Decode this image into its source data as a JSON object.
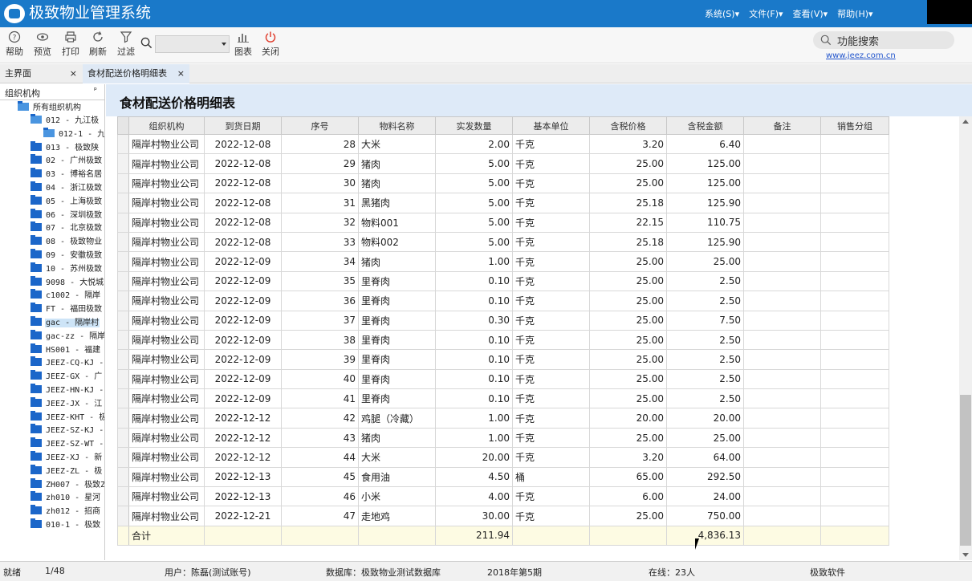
{
  "app": {
    "title": "极致物业管理系统"
  },
  "menu": {
    "items": [
      "系统(S)▾",
      "文件(F)▾",
      "查看(V)▾",
      "帮助(H)▾"
    ]
  },
  "toolbar": {
    "help": "帮助",
    "preview": "预览",
    "print": "打印",
    "refresh": "刷新",
    "filter": "过滤",
    "chart": "图表",
    "close": "关闭",
    "search_value": "",
    "func_search": "功能搜索",
    "site_link": "www.jeez.com.cn"
  },
  "tabs": {
    "main": "主界面",
    "report": "食材配送价格明细表",
    "close": "×"
  },
  "sidebar": {
    "title": "组织机构",
    "pin": "ᵖ",
    "root": "所有组织机构",
    "nodes": [
      "012 - 九江极",
      "012-1 - 九",
      "013 - 极致陕",
      "02 - 广州极致",
      "03 - 博裕名居",
      "04 - 浙江极致",
      "05 - 上海极致",
      "06 - 深圳极致",
      "07 - 北京极致",
      "08 - 极致物业",
      "09 - 安徽极致",
      "10 - 苏州极致",
      "9098 - 大悦城",
      "c1002 - 隔岸",
      "FT - 福田极致",
      "gac - 隔岸村",
      "gac-zz - 隔岸",
      "HS001 - 福建",
      "JEEZ-CQ-KJ -",
      "JEEZ-GX - 广",
      "JEEZ-HN-KJ -",
      "JEEZ-JX - 江",
      "JEEZ-KHT - 极",
      "JEEZ-SZ-KJ -",
      "JEEZ-SZ-WT -",
      "JEEZ-XJ - 新",
      "JEEZ-ZL - 极",
      "ZH007 - 极致Z",
      "zh010 - 星河",
      "zh012 - 招商",
      "010-1 - 极致"
    ]
  },
  "report": {
    "title": "食材配送价格明细表",
    "columns": [
      "组织机构",
      "到货日期",
      "序号",
      "物料名称",
      "实发数量",
      "基本单位",
      "含税价格",
      "含税金额",
      "备注",
      "销售分组"
    ],
    "rows": [
      [
        "隔岸村物业公司",
        "2022-12-08",
        "28",
        "大米",
        "2.00",
        "千克",
        "3.20",
        "6.40",
        "",
        ""
      ],
      [
        "隔岸村物业公司",
        "2022-12-08",
        "29",
        "猪肉",
        "5.00",
        "千克",
        "25.00",
        "125.00",
        "",
        ""
      ],
      [
        "隔岸村物业公司",
        "2022-12-08",
        "30",
        "猪肉",
        "5.00",
        "千克",
        "25.00",
        "125.00",
        "",
        ""
      ],
      [
        "隔岸村物业公司",
        "2022-12-08",
        "31",
        "黑猪肉",
        "5.00",
        "千克",
        "25.18",
        "125.90",
        "",
        ""
      ],
      [
        "隔岸村物业公司",
        "2022-12-08",
        "32",
        "物料001",
        "5.00",
        "千克",
        "22.15",
        "110.75",
        "",
        ""
      ],
      [
        "隔岸村物业公司",
        "2022-12-08",
        "33",
        "物料002",
        "5.00",
        "千克",
        "25.18",
        "125.90",
        "",
        ""
      ],
      [
        "隔岸村物业公司",
        "2022-12-09",
        "34",
        "猪肉",
        "1.00",
        "千克",
        "25.00",
        "25.00",
        "",
        ""
      ],
      [
        "隔岸村物业公司",
        "2022-12-09",
        "35",
        "里脊肉",
        "0.10",
        "千克",
        "25.00",
        "2.50",
        "",
        ""
      ],
      [
        "隔岸村物业公司",
        "2022-12-09",
        "36",
        "里脊肉",
        "0.10",
        "千克",
        "25.00",
        "2.50",
        "",
        ""
      ],
      [
        "隔岸村物业公司",
        "2022-12-09",
        "37",
        "里脊肉",
        "0.30",
        "千克",
        "25.00",
        "7.50",
        "",
        ""
      ],
      [
        "隔岸村物业公司",
        "2022-12-09",
        "38",
        "里脊肉",
        "0.10",
        "千克",
        "25.00",
        "2.50",
        "",
        ""
      ],
      [
        "隔岸村物业公司",
        "2022-12-09",
        "39",
        "里脊肉",
        "0.10",
        "千克",
        "25.00",
        "2.50",
        "",
        ""
      ],
      [
        "隔岸村物业公司",
        "2022-12-09",
        "40",
        "里脊肉",
        "0.10",
        "千克",
        "25.00",
        "2.50",
        "",
        ""
      ],
      [
        "隔岸村物业公司",
        "2022-12-09",
        "41",
        "里脊肉",
        "0.10",
        "千克",
        "25.00",
        "2.50",
        "",
        ""
      ],
      [
        "隔岸村物业公司",
        "2022-12-12",
        "42",
        "鸡腿（冷藏）",
        "1.00",
        "千克",
        "20.00",
        "20.00",
        "",
        ""
      ],
      [
        "隔岸村物业公司",
        "2022-12-12",
        "43",
        "猪肉",
        "1.00",
        "千克",
        "25.00",
        "25.00",
        "",
        ""
      ],
      [
        "隔岸村物业公司",
        "2022-12-12",
        "44",
        "大米",
        "20.00",
        "千克",
        "3.20",
        "64.00",
        "",
        ""
      ],
      [
        "隔岸村物业公司",
        "2022-12-13",
        "45",
        "食用油",
        "4.50",
        "桶",
        "65.00",
        "292.50",
        "",
        ""
      ],
      [
        "隔岸村物业公司",
        "2022-12-13",
        "46",
        "小米",
        "4.00",
        "千克",
        "6.00",
        "24.00",
        "",
        ""
      ],
      [
        "隔岸村物业公司",
        "2022-12-21",
        "47",
        "走地鸡",
        "30.00",
        "千克",
        "25.00",
        "750.00",
        "",
        ""
      ]
    ],
    "total": {
      "label": "合计",
      "quantity": "211.94",
      "amount": "4,836.13"
    }
  },
  "status": {
    "ready": "就绪",
    "page": "1/48",
    "user": "用户：陈磊(测试账号)",
    "database": "数据库：极致物业测试数据库",
    "period": "2018年第5期",
    "online": "在线：23人",
    "vendor": "极致软件"
  },
  "colors": {
    "titlebar": "#1a79c9",
    "report_header": "#deeaf8",
    "total_row": "#fdfbe3",
    "folder": "#1b66c9"
  }
}
